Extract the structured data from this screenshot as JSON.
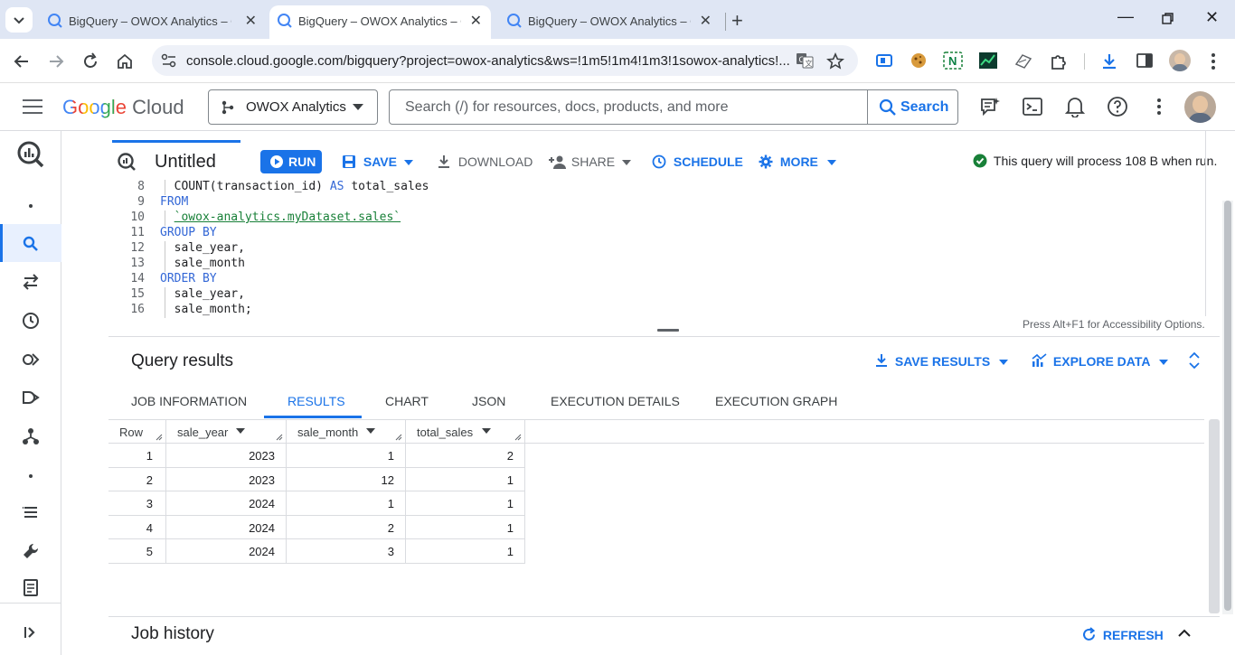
{
  "browser": {
    "tabs": [
      {
        "title": "BigQuery – OWOX Analytics – G"
      },
      {
        "title": "BigQuery – OWOX Analytics – G"
      },
      {
        "title": "BigQuery – OWOX Analytics – G"
      }
    ],
    "url": "console.cloud.google.com/bigquery?project=owox-analytics&ws=!1m5!1m4!1m3!1sowox-analytics!..."
  },
  "header": {
    "logo_google": "Google",
    "logo_cloud": "Cloud",
    "project": "OWOX Analytics",
    "search_placeholder": "Search (/) for resources, docs, products, and more",
    "search_button": "Search"
  },
  "toolbar": {
    "title": "Untitled",
    "run": "RUN",
    "save": "SAVE",
    "download": "DOWNLOAD",
    "share": "SHARE",
    "schedule": "SCHEDULE",
    "more": "MORE",
    "status": "This query will process 108 B when run."
  },
  "editor": {
    "lines": [
      {
        "num": "8",
        "parts": [
          {
            "t": "  COUNT(transaction_id) ",
            "c": ""
          },
          {
            "t": "AS",
            "c": "kw"
          },
          {
            "t": " total_sales",
            "c": ""
          }
        ]
      },
      {
        "num": "9",
        "parts": [
          {
            "t": "FROM",
            "c": "kw"
          }
        ]
      },
      {
        "num": "10",
        "parts": [
          {
            "t": "  ",
            "c": ""
          },
          {
            "t": "`owox-analytics.myDataset.sales`",
            "c": "str"
          }
        ]
      },
      {
        "num": "11",
        "parts": [
          {
            "t": "GROUP BY",
            "c": "kw"
          }
        ]
      },
      {
        "num": "12",
        "parts": [
          {
            "t": "  sale_year,",
            "c": ""
          }
        ]
      },
      {
        "num": "13",
        "parts": [
          {
            "t": "  sale_month",
            "c": ""
          }
        ]
      },
      {
        "num": "14",
        "parts": [
          {
            "t": "ORDER BY",
            "c": "kw"
          }
        ]
      },
      {
        "num": "15",
        "parts": [
          {
            "t": "  sale_year,",
            "c": ""
          }
        ]
      },
      {
        "num": "16",
        "parts": [
          {
            "t": "  sale_month;",
            "c": ""
          }
        ]
      }
    ],
    "accessibility_hint": "Press Alt+F1 for Accessibility Options."
  },
  "results": {
    "title": "Query results",
    "save_results": "SAVE RESULTS",
    "explore_data": "EXPLORE DATA",
    "tabs": [
      "JOB INFORMATION",
      "RESULTS",
      "CHART",
      "JSON",
      "EXECUTION DETAILS",
      "EXECUTION GRAPH"
    ],
    "active_tab": "RESULTS",
    "columns": [
      "Row",
      "sale_year",
      "sale_month",
      "total_sales"
    ],
    "rows": [
      [
        "1",
        "2023",
        "1",
        "2"
      ],
      [
        "2",
        "2023",
        "12",
        "1"
      ],
      [
        "3",
        "2024",
        "1",
        "1"
      ],
      [
        "4",
        "2024",
        "2",
        "1"
      ],
      [
        "5",
        "2024",
        "3",
        "1"
      ]
    ]
  },
  "job_history": {
    "title": "Job history",
    "refresh": "REFRESH"
  },
  "colors": {
    "accent": "#1a73e8",
    "success": "#188038"
  }
}
